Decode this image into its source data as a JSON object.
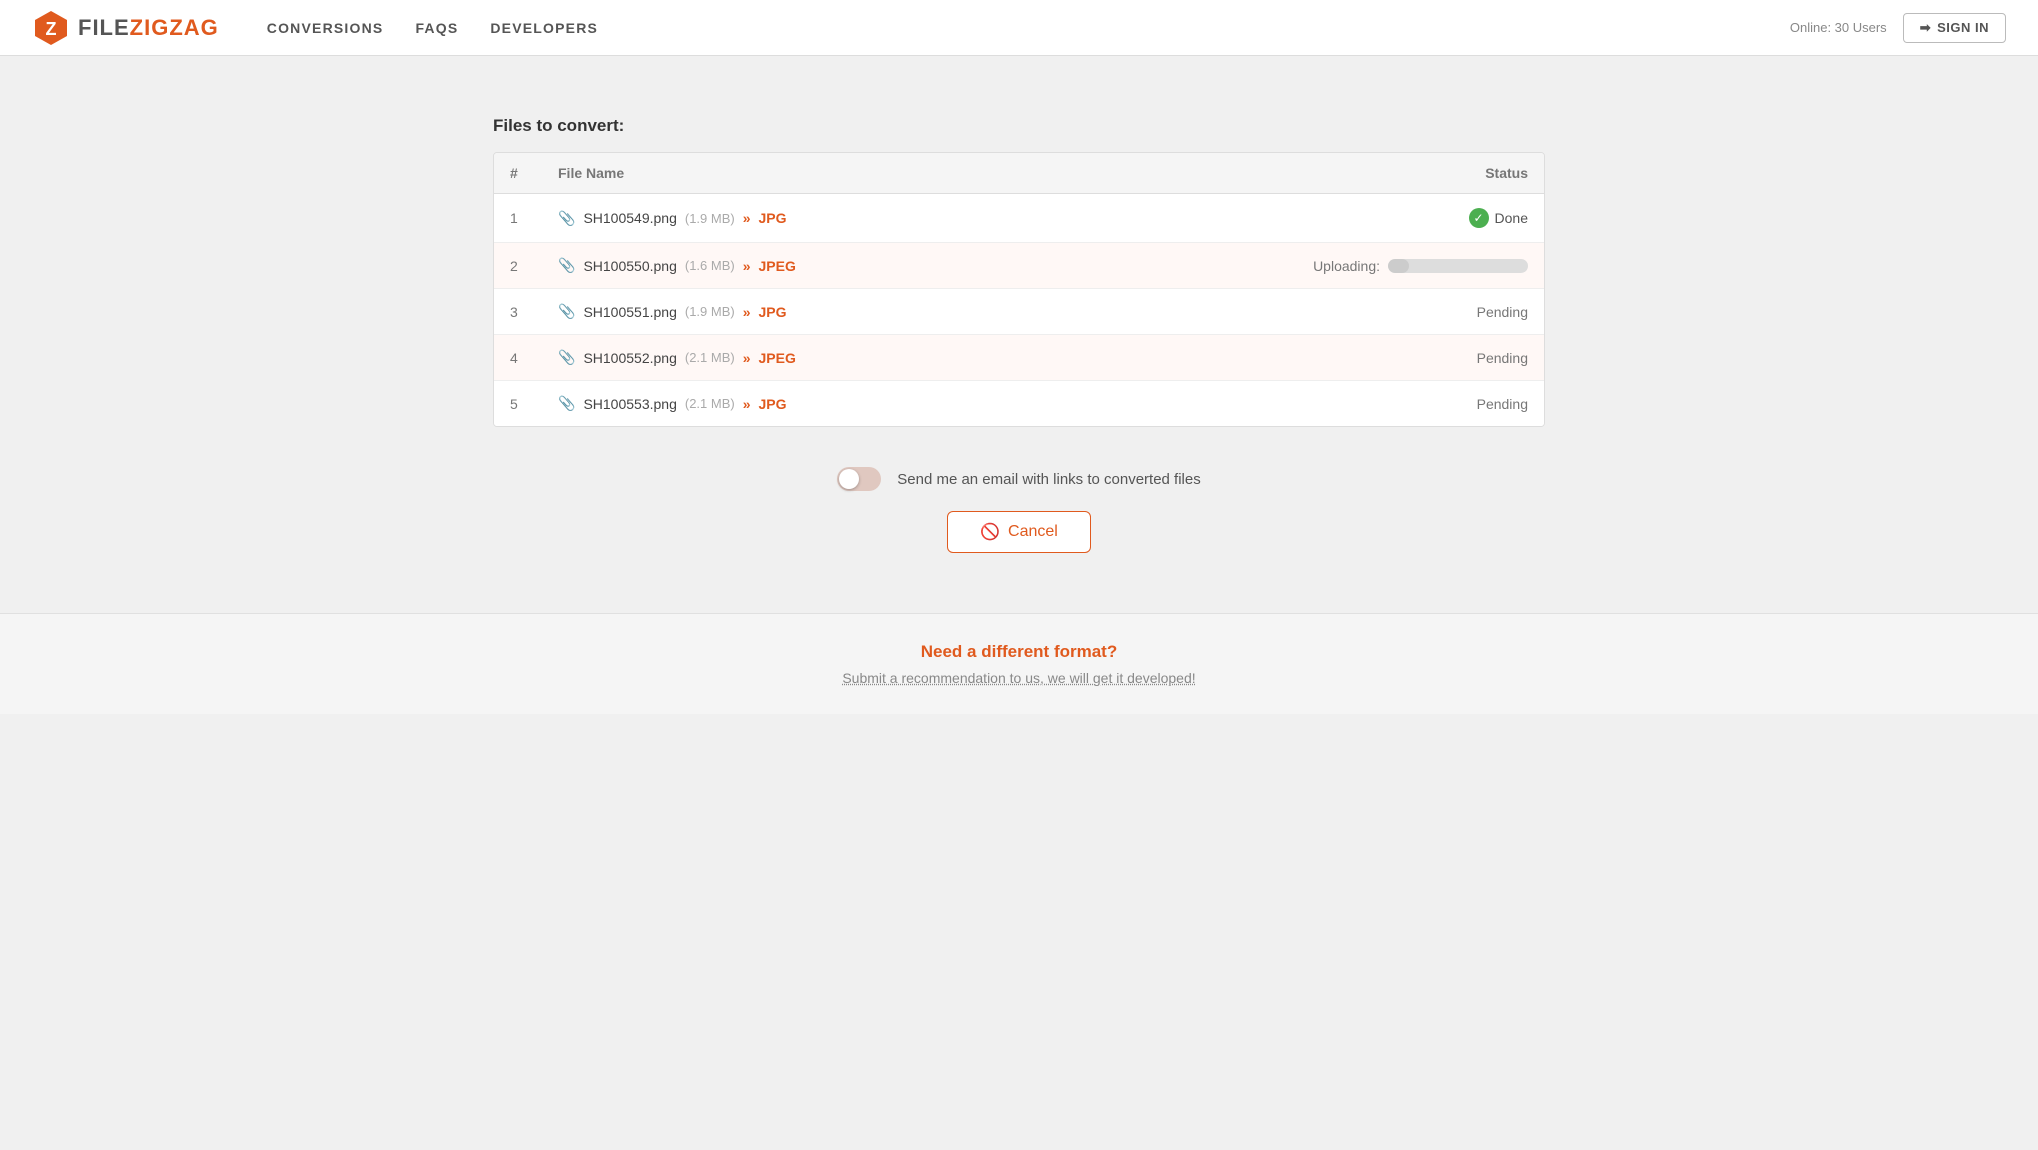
{
  "header": {
    "logo_file": "FILE",
    "logo_zigzag": "ZIGZAG",
    "nav": [
      {
        "label": "CONVERSIONS",
        "href": "#"
      },
      {
        "label": "FAQs",
        "href": "#"
      },
      {
        "label": "DEVELOPERS",
        "href": "#"
      }
    ],
    "online_users": "Online: 30 Users",
    "sign_in": "SIGN IN"
  },
  "main": {
    "section_title": "Files to convert:",
    "table": {
      "columns": [
        "#",
        "File Name",
        "Status"
      ],
      "rows": [
        {
          "num": "1",
          "filename": "SH100549.png",
          "size": "(1.9 MB)",
          "format": "JPG",
          "status_type": "done",
          "status_text": "Done",
          "row_style": "normal"
        },
        {
          "num": "2",
          "filename": "SH100550.png",
          "size": "(1.6 MB)",
          "format": "JPEG",
          "status_type": "uploading",
          "status_text": "Uploading:",
          "progress": 15,
          "row_style": "alt"
        },
        {
          "num": "3",
          "filename": "SH100551.png",
          "size": "(1.9 MB)",
          "format": "JPG",
          "status_type": "pending",
          "status_text": "Pending",
          "row_style": "normal"
        },
        {
          "num": "4",
          "filename": "SH100552.png",
          "size": "(2.1 MB)",
          "format": "JPEG",
          "status_type": "pending",
          "status_text": "Pending",
          "row_style": "alt"
        },
        {
          "num": "5",
          "filename": "SH100553.png",
          "size": "(2.1 MB)",
          "format": "JPG",
          "status_type": "pending",
          "status_text": "Pending",
          "row_style": "normal"
        }
      ]
    },
    "email_toggle_label": "Send me an email with links to converted files",
    "cancel_button": "Cancel"
  },
  "footer": {
    "title": "Need a different format?",
    "subtitle": "Submit a recommendation to us, we will get it developed!"
  },
  "colors": {
    "accent": "#e05a1e",
    "done_green": "#4caf50"
  }
}
